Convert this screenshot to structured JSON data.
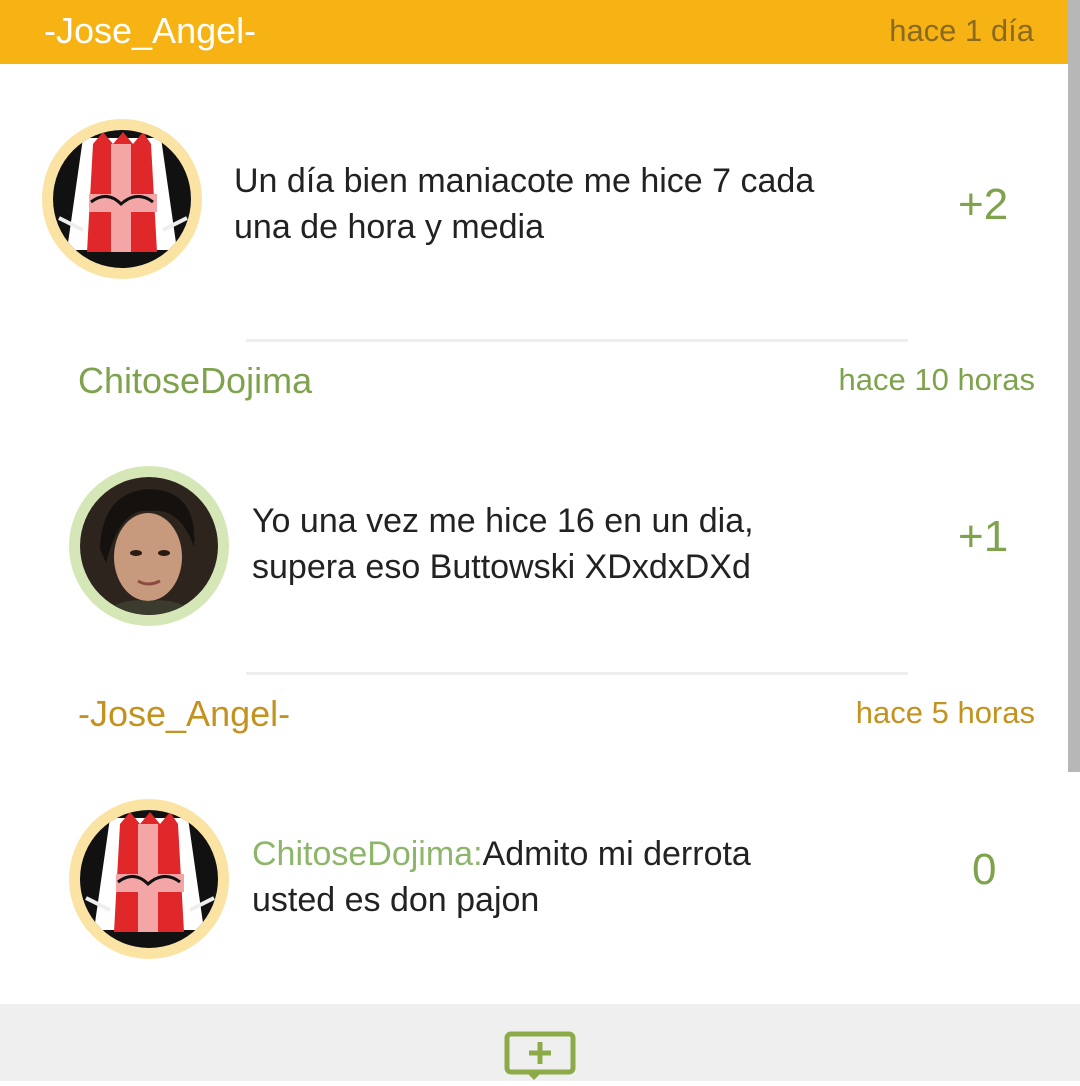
{
  "thread_header": {
    "username": "-Jose_Angel-",
    "timestamp": "hace 1 día"
  },
  "comments": [
    {
      "text": "Un día bien maniacote me hice 7 cada una de hora y media",
      "line1": "Un día bien maniacote me hice 7 cada",
      "line2": "una de hora y media",
      "score": "+2",
      "avatar_icon": "knight-avatar"
    },
    {
      "username": "ChitoseDojima",
      "timestamp": "hace 10 horas",
      "line1": "Yo una vez me hice 16 en un dia,",
      "line2": "supera eso Buttowski XDxdxDXd",
      "score": "+1",
      "avatar_icon": "woman-portrait-avatar"
    },
    {
      "username": "-Jose_Angel-",
      "timestamp": "hace 5 horas",
      "mention": "ChitoseDojima:",
      "line1": "Admito mi derrota",
      "line2": "usted es don pajon",
      "score": "0",
      "avatar_icon": "knight-avatar"
    }
  ],
  "footer": {
    "compose_icon": "add-comment-icon"
  },
  "colors": {
    "header_bg": "#f7b314",
    "green_user": "#7fa24d",
    "gold_user": "#c4921e",
    "score_green": "#7fa24d"
  }
}
